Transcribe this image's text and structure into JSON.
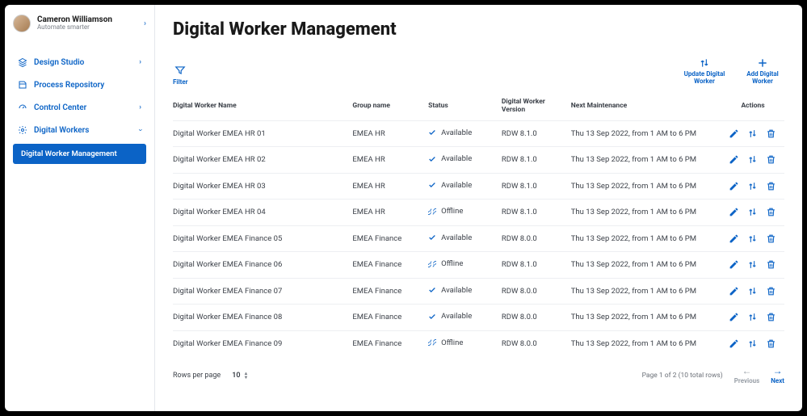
{
  "user": {
    "name": "Cameron Williamson",
    "tagline": "Automate smarter"
  },
  "sidebar": {
    "items": [
      {
        "label": "Design Studio",
        "icon": "layers-icon",
        "hasCaret": true
      },
      {
        "label": "Process Repository",
        "icon": "repository-icon",
        "hasCaret": false
      },
      {
        "label": "Control Center",
        "icon": "gauge-icon",
        "hasCaret": true
      },
      {
        "label": "Digital Workers",
        "icon": "gear-icon",
        "hasCaret": true,
        "expanded": true
      }
    ],
    "activeSub": "Digital Worker Management"
  },
  "page": {
    "title": "Digital Worker Management"
  },
  "toolbar": {
    "filter": "Filter",
    "update": "Update Digital Worker",
    "add": "Add Digital Worker"
  },
  "table": {
    "headers": {
      "name": "Digital Worker Name",
      "group": "Group name",
      "status": "Status",
      "version": "Digital Worker Version",
      "maintenance": "Next Maintenance",
      "actions": "Actions"
    },
    "rows": [
      {
        "name": "Digital Worker EMEA HR 01",
        "group": "EMEA HR",
        "status": "Available",
        "version": "RDW 8.1.0",
        "maintenance": "Thu 13 Sep 2022,  from 1 AM to 6 PM"
      },
      {
        "name": "Digital Worker EMEA HR 02",
        "group": "EMEA HR",
        "status": "Available",
        "version": "RDW 8.1.0",
        "maintenance": "Thu 13 Sep 2022,  from 1 AM to 6 PM"
      },
      {
        "name": "Digital Worker EMEA HR 03",
        "group": "EMEA HR",
        "status": "Available",
        "version": "RDW 8.1.0",
        "maintenance": "Thu 13 Sep 2022,  from 1 AM to 6 PM"
      },
      {
        "name": "Digital Worker EMEA HR 04",
        "group": "EMEA HR",
        "status": "Offline",
        "version": "RDW 8.1.0",
        "maintenance": "Thu 13 Sep 2022,  from 1 AM to 6 PM"
      },
      {
        "name": "Digital Worker EMEA Finance 05",
        "group": "EMEA Finance",
        "status": "Available",
        "version": "RDW 8.0.0",
        "maintenance": "Thu 13 Sep 2022,  from 1 AM to 6 PM"
      },
      {
        "name": "Digital Worker EMEA Finance 06",
        "group": "EMEA Finance",
        "status": "Offline",
        "version": "RDW 8.1.0",
        "maintenance": "Thu 13 Sep 2022,  from 1 AM to 6 PM"
      },
      {
        "name": "Digital Worker EMEA Finance 07",
        "group": "EMEA Finance",
        "status": "Available",
        "version": "RDW 8.0.0",
        "maintenance": "Thu 13 Sep 2022,  from 1 AM to 6 PM"
      },
      {
        "name": "Digital Worker EMEA Finance 08",
        "group": "EMEA Finance",
        "status": "Available",
        "version": "RDW 8.0.0",
        "maintenance": "Thu 13 Sep 2022,  from 1 AM to 6 PM"
      },
      {
        "name": "Digital Worker EMEA Finance 09",
        "group": "EMEA Finance",
        "status": "Offline",
        "version": "RDW 8.0.0",
        "maintenance": "Thu 13 Sep 2022,  from 1 AM to 6 PM"
      }
    ]
  },
  "footer": {
    "rowsPerPageLabel": "Rows per page",
    "rowsPerPageValue": "10",
    "pageInfo": "Page 1 of 2 (10 total rows)",
    "prev": "Previous",
    "next": "Next"
  },
  "icons": {
    "check": "check-icon",
    "offline": "unlink-icon",
    "edit": "pencil-icon",
    "update": "update-icon",
    "delete": "trash-icon"
  }
}
